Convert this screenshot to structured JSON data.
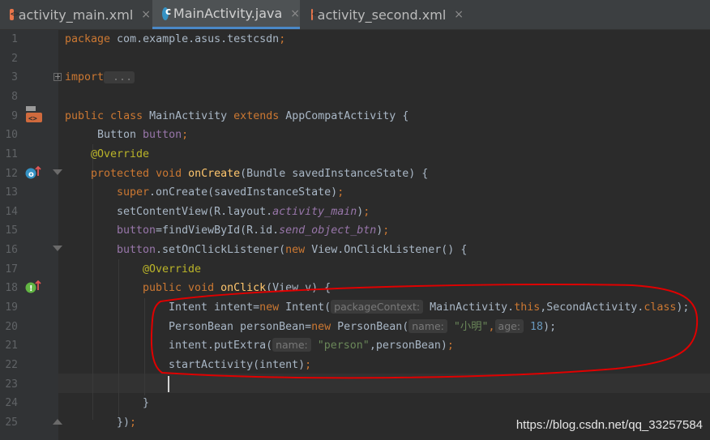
{
  "tabs": [
    {
      "label": "activity_main.xml",
      "type": "xml",
      "active": false
    },
    {
      "label": "MainActivity.java",
      "type": "java",
      "active": true
    },
    {
      "label": "activity_second.xml",
      "type": "xml",
      "active": false
    }
  ],
  "close_glyph": "×",
  "line_numbers": [
    "1",
    "2",
    "3",
    "8",
    "9",
    "10",
    "11",
    "12",
    "13",
    "14",
    "15",
    "16",
    "17",
    "18",
    "19",
    "20",
    "21",
    "22",
    "23",
    "24",
    "25"
  ],
  "code": {
    "l1_kw": "package",
    "l1_rest": " com.example.asus.testcsdn",
    "l1_semi": ";",
    "l3_kw": "import",
    "l3_fold": " ...",
    "l9_public": "public",
    "l9_class": " class",
    "l9_name": " MainActivity",
    "l9_extends": " extends",
    "l9_rest": " AppCompatActivity {",
    "l10_type": "Button",
    "l10_field": " button",
    "l10_semi": ";",
    "l11_annot": "@Override",
    "l12_protected": "protected",
    "l12_void": " void",
    "l12_fn": " onCreate",
    "l12_rest": "(Bundle savedInstanceState) {",
    "l13_super": "super",
    "l13_rest": ".onCreate(savedInstanceState)",
    "l13_semi": ";",
    "l14_a": "setContentView(R.layout.",
    "l14_b": "activity_main",
    "l14_c": ")",
    "l14_semi": ";",
    "l15_field": "button",
    "l15_a": "=findViewById(R.id.",
    "l15_b": "send_object_btn",
    "l15_c": ")",
    "l15_semi": ";",
    "l16_field": "button",
    "l16_a": ".setOnClickListener(",
    "l16_new": "new",
    "l16_b": " View.OnClickListener() {",
    "l17_annot": "@Override",
    "l18_public": "public",
    "l18_void": " void",
    "l18_fn": " onClick",
    "l18_rest": "(View v) {",
    "l19_a": "Intent intent=",
    "l19_new": "new",
    "l19_b": " Intent(",
    "l19_hint": "packageContext:",
    "l19_c": " MainActivity.",
    "l19_this": "this",
    "l19_d": ",SecondActivity.",
    "l19_class": "class",
    "l19_e": ");",
    "l20_a": "PersonBean personBean=",
    "l20_new": "new",
    "l20_b": " PersonBean(",
    "l20_hint1": "name:",
    "l20_str": " \"小明\"",
    "l20_comma": ",",
    "l20_hint2": "age:",
    "l20_num": " 18",
    "l20_e": ");",
    "l21_a": "intent.putExtra(",
    "l21_hint": "name:",
    "l21_str": " \"person\"",
    "l21_b": ",personBean)",
    "l21_semi": ";",
    "l22_a": "startActivity(intent)",
    "l22_semi": ";",
    "l24": "}",
    "l25_a": "})",
    "l25_semi": ";"
  },
  "watermark": "https://blog.csdn.net/qq_33257584",
  "colors": {
    "keyword": "#cc7832",
    "annotation": "#bbb529",
    "function": "#ffc66d",
    "field": "#9876aa",
    "string": "#6a8759",
    "number": "#6897bb",
    "highlight": "#e00000"
  }
}
